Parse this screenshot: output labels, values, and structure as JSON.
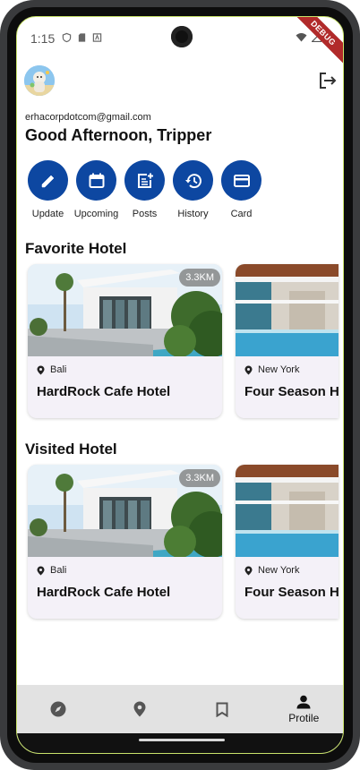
{
  "status_bar": {
    "time": "1:15",
    "debug_label": "DEBUG"
  },
  "user": {
    "email": "erhacorpdotcom@gmail.com",
    "greeting": "Good Afternoon, Tripper"
  },
  "actions": [
    {
      "label": "Update",
      "icon": "pencil-icon"
    },
    {
      "label": "Upcoming",
      "icon": "calendar-icon"
    },
    {
      "label": "Posts",
      "icon": "post-add-icon"
    },
    {
      "label": "History",
      "icon": "history-icon"
    },
    {
      "label": "Card",
      "icon": "credit-card-icon"
    }
  ],
  "favorite": {
    "title": "Favorite Hotel",
    "cards": [
      {
        "distance": "3.3KM",
        "location": "Bali",
        "name": "HardRock Cafe Hotel"
      },
      {
        "location": "New York",
        "name": "Four Season H"
      }
    ]
  },
  "visited": {
    "title": "Visited Hotel",
    "cards": [
      {
        "distance": "3.3KM",
        "location": "Bali",
        "name": "HardRock Cafe Hotel"
      },
      {
        "location": "New York",
        "name": "Four Season H"
      }
    ]
  },
  "bottom_nav": {
    "items": [
      {
        "icon": "compass-icon",
        "label": ""
      },
      {
        "icon": "location-pin-icon",
        "label": ""
      },
      {
        "icon": "bookmark-icon",
        "label": ""
      },
      {
        "icon": "person-icon",
        "label": "Protile"
      }
    ]
  },
  "colors": {
    "accent": "#0d47a1",
    "nav_bg": "#e2e2e2",
    "card_bg": "#f4f1f8"
  }
}
